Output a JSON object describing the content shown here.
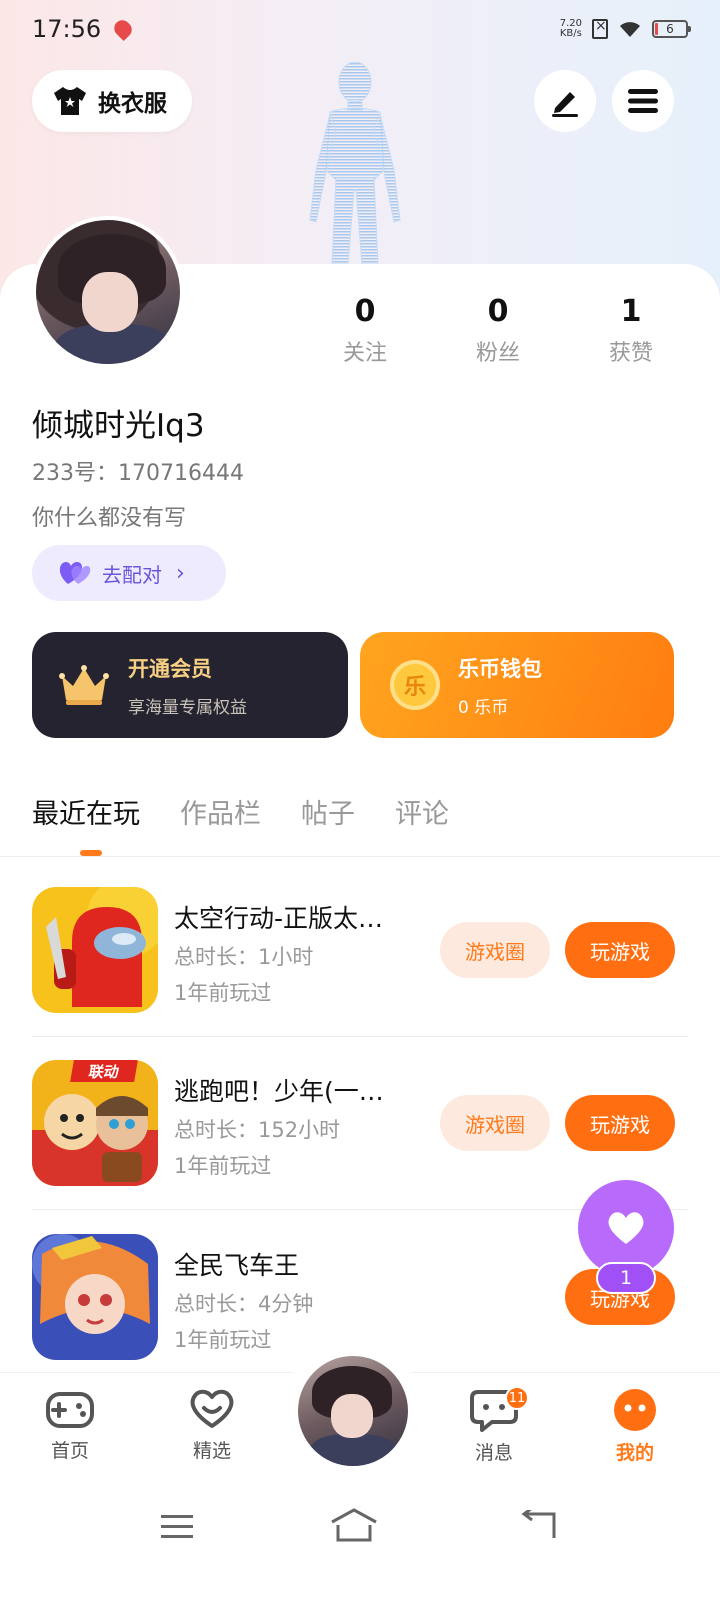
{
  "status_bar": {
    "time": "17:56",
    "net_speed_value": "7.20",
    "net_speed_unit": "KB/s",
    "battery": "6",
    "icons": [
      "location-icon",
      "sim-off-icon",
      "wifi-icon",
      "battery-icon"
    ]
  },
  "header": {
    "dress_label": "换衣服",
    "dress_icon": "shirt-icon",
    "edit_icon": "edit-icon",
    "menu_icon": "menu-icon"
  },
  "profile": {
    "username": "倾城时光Iq3",
    "uid": "233号：170716444",
    "bio": "你什么都没有写",
    "match_label": "去配对",
    "stats": [
      {
        "value": "0",
        "label": "关注"
      },
      {
        "value": "0",
        "label": "粉丝"
      },
      {
        "value": "1",
        "label": "获赞"
      }
    ]
  },
  "cards": {
    "vip": {
      "title": "开通会员",
      "subtitle": "享海量专属权益"
    },
    "wallet": {
      "title": "乐币钱包",
      "subtitle": "0 乐币",
      "coin_glyph": "乐"
    }
  },
  "tabs": [
    "最近在玩",
    "作品栏",
    "帖子",
    "评论"
  ],
  "active_tab": "最近在玩",
  "games": [
    {
      "name": "太空行动-正版太…",
      "time": "总时长：1小时",
      "last": "1年前玩过",
      "circle_label": "游戏圈",
      "play_label": "玩游戏"
    },
    {
      "name": "逃跑吧！少年(一…",
      "time": "总时长：152小时",
      "last": "1年前玩过",
      "circle_label": "游戏圈",
      "play_label": "玩游戏",
      "icon_tag": "联动"
    },
    {
      "name": "全民飞车王",
      "time": "总时长：4分钟",
      "last": "1年前玩过",
      "play_label": "玩游戏"
    }
  ],
  "float_like": {
    "count": "1"
  },
  "bottom_nav": {
    "items": [
      "首页",
      "精选",
      "消息",
      "我的"
    ],
    "message_badge": "11",
    "active": "我的"
  },
  "colors": {
    "accent": "#ff7a1a",
    "match": "#6c55d9",
    "like": "#b86bfb",
    "vip_bg": "#25232f"
  }
}
